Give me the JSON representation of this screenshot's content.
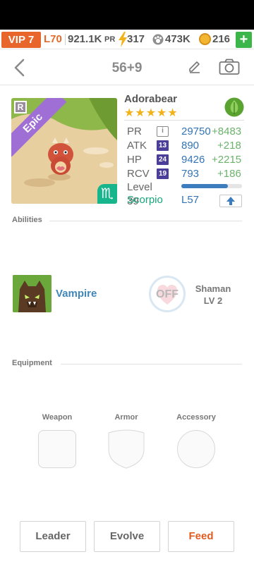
{
  "topbar": {
    "vip": "VIP 7",
    "level": "L70",
    "power": "921.1K",
    "power_label": "PR",
    "energy": "317",
    "paws": "473K",
    "coins": "216",
    "add_label": "+"
  },
  "nav": {
    "title": "56+9"
  },
  "pet": {
    "name": "Adorabear",
    "stars": "★★★★★",
    "rarity": "Epic",
    "rarity_badge": "R",
    "zodiac_symbol": "♏",
    "element": "leaf-icon",
    "stats": {
      "pr_label": "PR",
      "pr_value": "29750",
      "pr_bonus": "+8483",
      "pr_icon": "i",
      "atk_label": "ATK",
      "atk_rank": "13",
      "atk_value": "890",
      "atk_bonus": "+218",
      "hp_label": "HP",
      "hp_rank": "24",
      "hp_value": "9426",
      "hp_bonus": "+2215",
      "rcv_label": "RCV",
      "rcv_rank": "19",
      "rcv_value": "793",
      "rcv_bonus": "+186"
    },
    "level_label": "Level 39",
    "level_progress": 0.77,
    "zodiac_name": "Scorpio",
    "zodiac_level": "L57"
  },
  "abilities": {
    "section_label": "Abilities",
    "ability_name": "Vampire",
    "skill_state": "OFF",
    "skill_name_line1": "Shaman",
    "skill_name_line2": "LV 2"
  },
  "equipment": {
    "section_label": "Equipment",
    "weapon_label": "Weapon",
    "armor_label": "Armor",
    "accessory_label": "Accessory"
  },
  "actions": {
    "leader": "Leader",
    "evolve": "Evolve",
    "feed": "Feed"
  },
  "colors": {
    "vip": "#e8652b",
    "accent_blue": "#3374b5",
    "bonus_green": "#6bb36a",
    "zodiac_green": "#17a57b",
    "feed_red": "#e05a1e",
    "epic_purple": "#a06fd6"
  }
}
